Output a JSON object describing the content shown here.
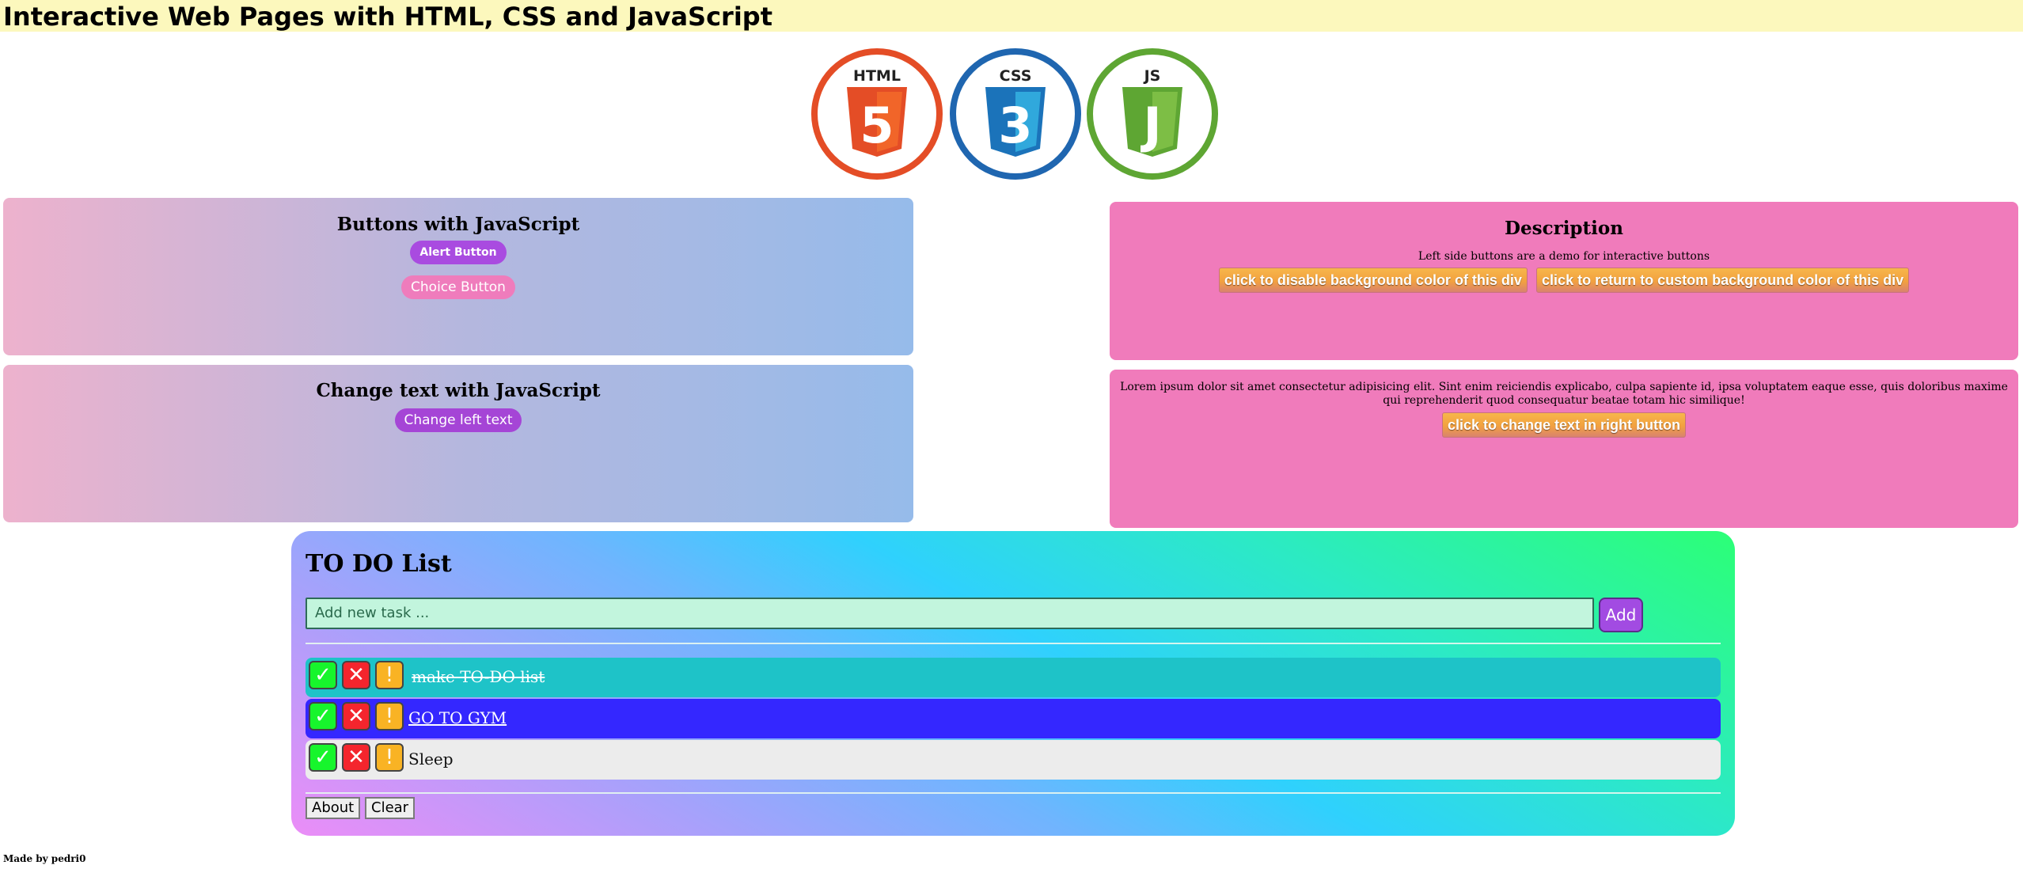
{
  "header": {
    "title": "Interactive Web Pages with HTML, CSS and JavaScript"
  },
  "logos": {
    "html": {
      "label": "HTML",
      "digit": "5",
      "ring_color": "#e44d26",
      "shield_color": "#e44d26",
      "shield_light": "#f16529"
    },
    "css": {
      "label": "CSS",
      "digit": "3",
      "ring_color": "#1f66b0",
      "shield_color": "#1b73ba",
      "shield_light": "#30a8dc"
    },
    "js": {
      "label": "JS",
      "digit": "J",
      "ring_color": "#5ea633",
      "shield_color": "#5ea633",
      "shield_light": "#7dbe45"
    }
  },
  "left_panels": {
    "buttons": {
      "title": "Buttons with JavaScript",
      "alert_label": "Alert Button",
      "choice_label": "Choice Button"
    },
    "change_text": {
      "title": "Change text with JavaScript",
      "change_label": "Change left text"
    }
  },
  "right_panels": {
    "description": {
      "title": "Description",
      "text": "Left side buttons are a demo for interactive buttons",
      "disable_label": "click to disable background color of this div",
      "return_label": "click to return to custom background color of this div"
    },
    "lorem": {
      "text": "Lorem ipsum dolor sit amet consectetur adipisicing elit. Sint enim reiciendis explicabo, culpa sapiente id, ipsa voluptatem eaque esse, quis doloribus maxime qui reprehenderit quod consequatur beatae totam hic similique!",
      "change_label": "click to change text in right button"
    }
  },
  "todo": {
    "title": "TO DO List",
    "input_placeholder": "Add new task ...",
    "add_label": "Add",
    "icons": {
      "done": "✓",
      "delete": "✕",
      "important": "!"
    },
    "tasks": [
      {
        "text": "make TO-DO list",
        "state": "done",
        "bg": "#1ec3c8",
        "color": "#ffffff"
      },
      {
        "text": "GO TO GYM",
        "state": "important",
        "bg": "#3427ff",
        "color": "#ffffff"
      },
      {
        "text": "Sleep",
        "state": "normal",
        "bg": "#ececec",
        "color": "#111111"
      }
    ],
    "about_label": "About",
    "clear_label": "Clear"
  },
  "footer": {
    "text": "Made by pedri0"
  }
}
